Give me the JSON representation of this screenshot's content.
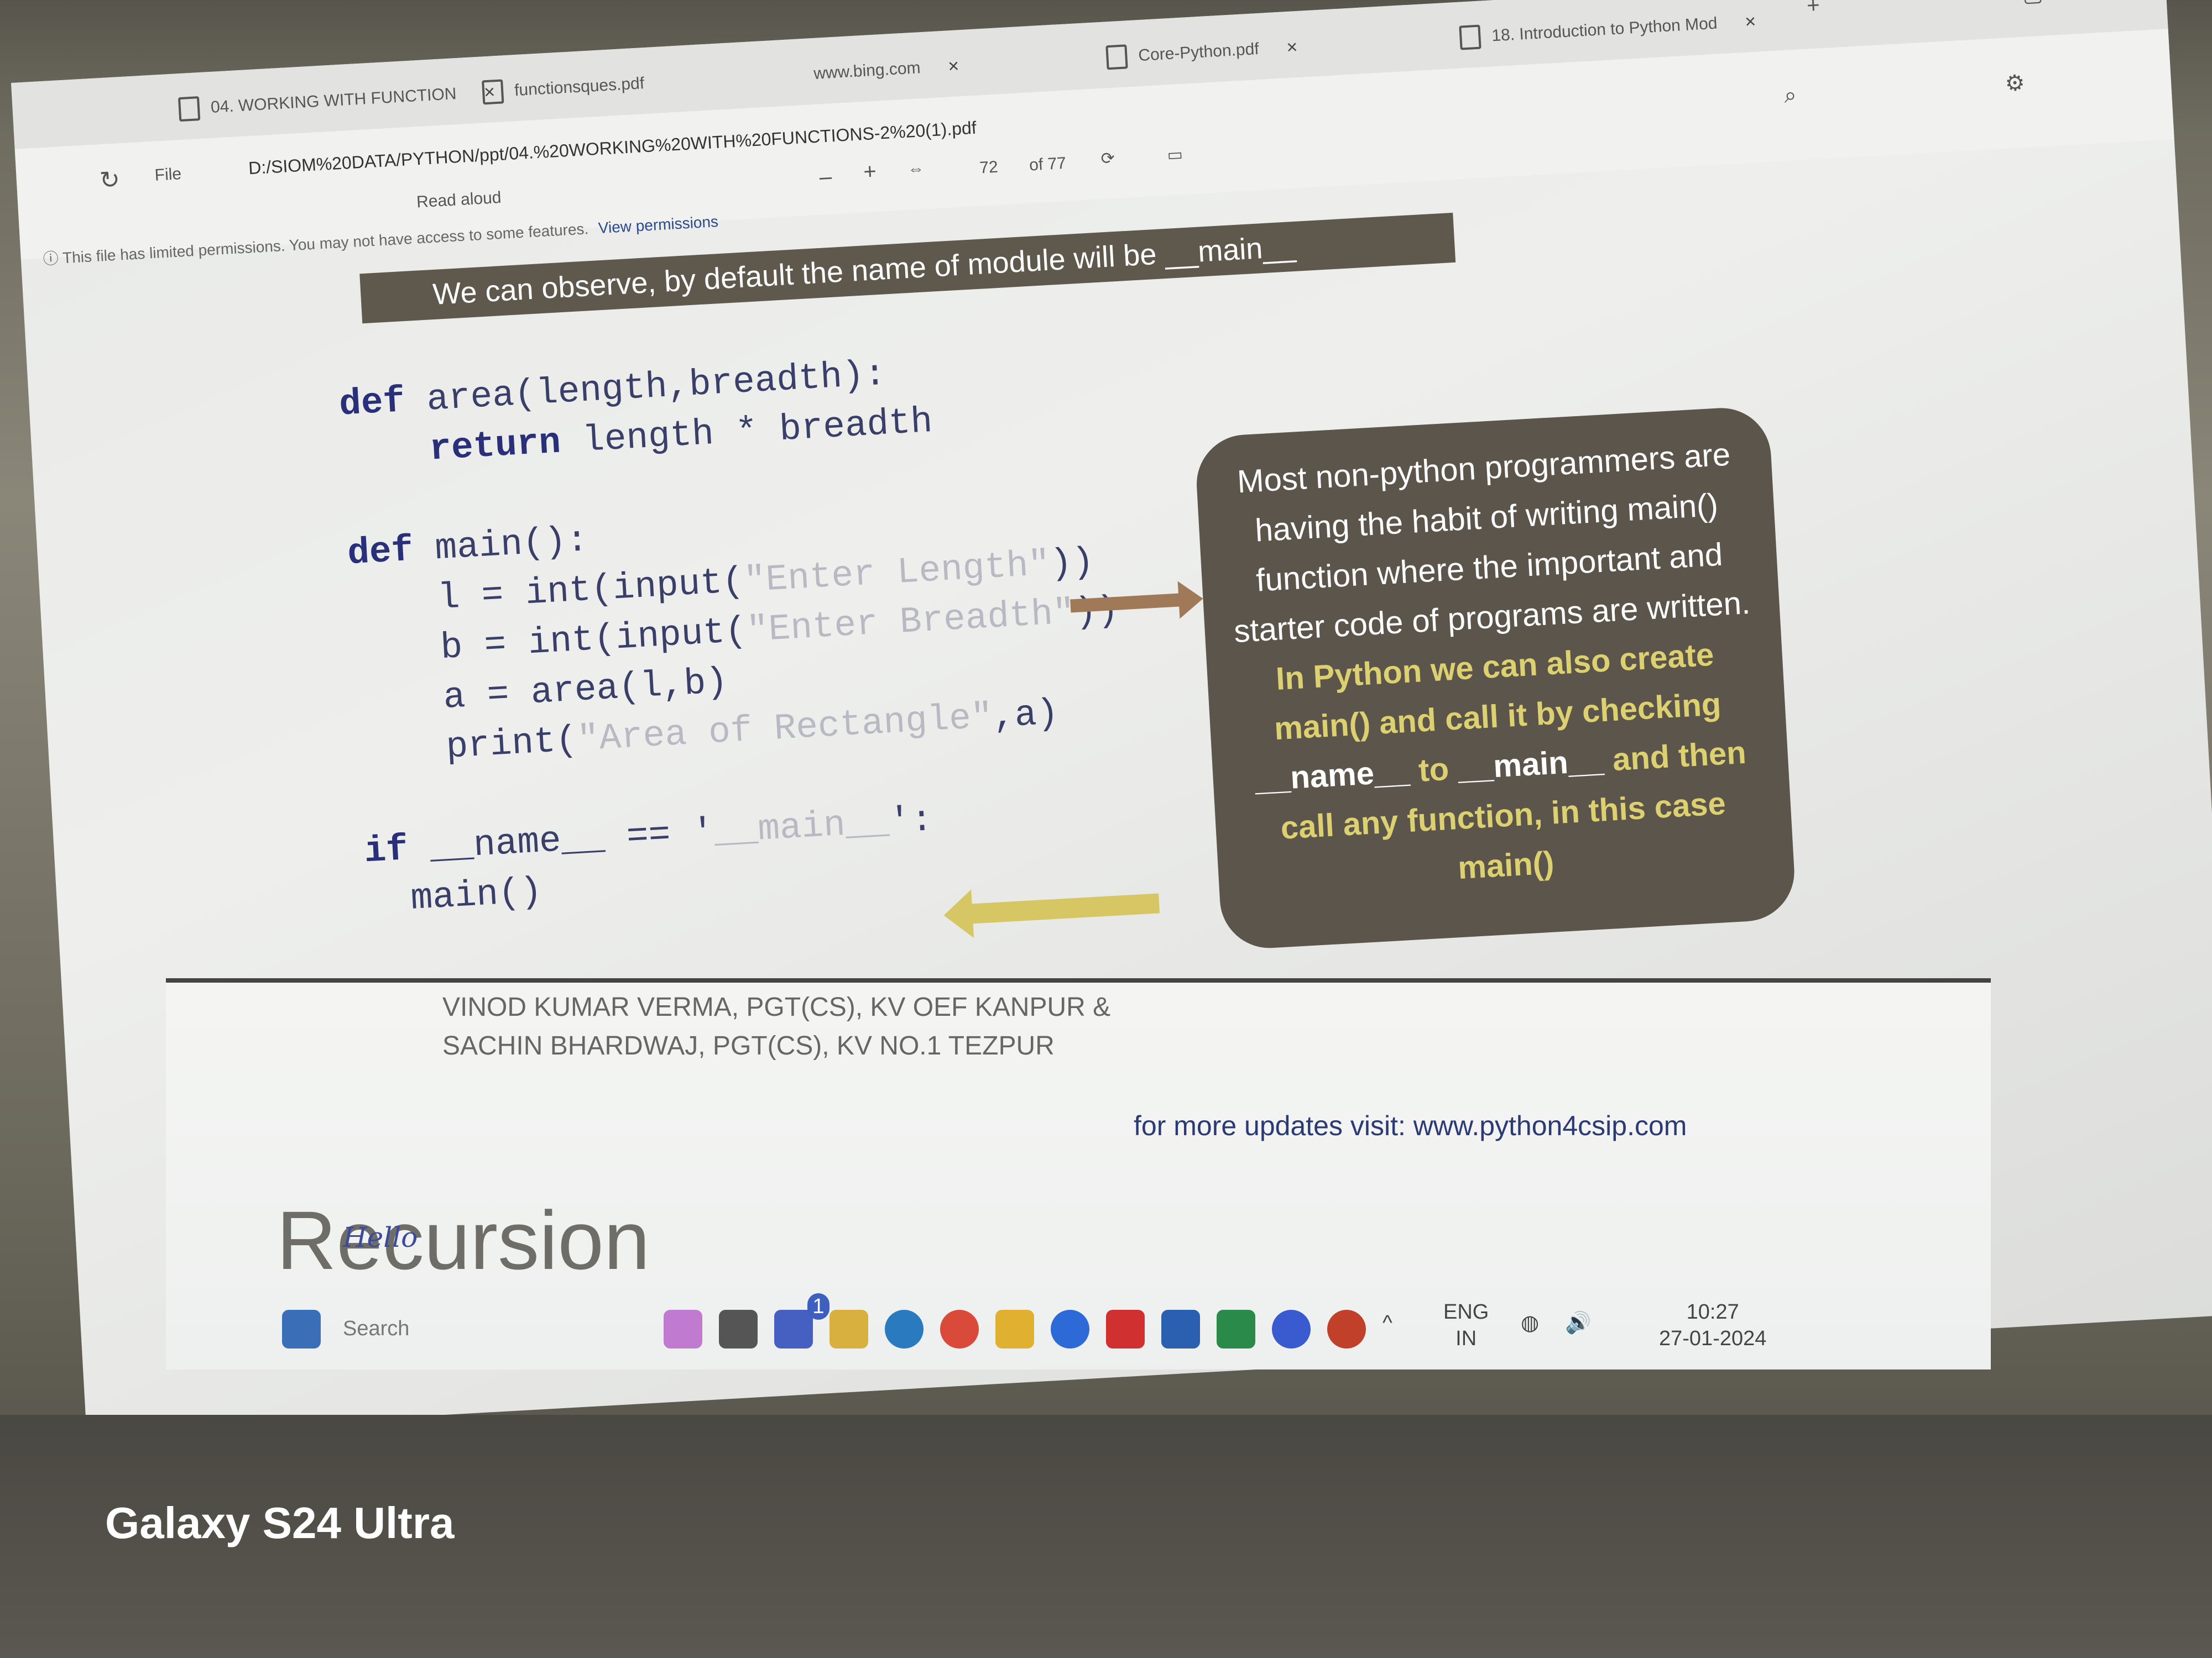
{
  "browser": {
    "tabs": [
      {
        "label": "04. WORKING WITH FUNCTION"
      },
      {
        "label": "functionsques.pdf"
      },
      {
        "label": "www.bing.com"
      },
      {
        "label": "Core-Python.pdf"
      },
      {
        "label": "18. Introduction to Python Mod"
      }
    ],
    "address": "D:/SIOM%20DATA/PYTHON/ppt/04.%20WORKING%20WITH%20FUNCTIONS-2%20(1).pdf",
    "file_label": "File",
    "read_aloud": "Read aloud",
    "page_current": "72",
    "page_total": "of 77",
    "permission_text": "This file has limited permissions. You may not have access to some features.",
    "permission_link": "View permissions"
  },
  "slide": {
    "banner": "We can observe, by default the name of module will be __main__",
    "code": {
      "line1_kw": "def",
      "line1": " area(length,breadth):",
      "line2_kw": "return",
      "line2": " length * breadth",
      "line3_kw": "def",
      "line3": " main():",
      "line4a": "l = int(input(",
      "line4s": "\"Enter Length\"",
      "line4b": "))",
      "line5a": "b = int(input(",
      "line5s": "\"Enter Breadth\"",
      "line5b": "))",
      "line6": "a = area(l,b)",
      "line7a": "print(",
      "line7s": "\"Area of Rectangle\"",
      "line7b": ",a)",
      "line8_kw": "if",
      "line8a": " __name__ == '",
      "line8s": "__main__",
      "line8b": "':",
      "line9": "main()"
    },
    "note": {
      "plain": "Most non-python programmers are having the habit of writing main() function where the important and starter code of programs are written.",
      "highlight1": "In Python we can also create main() and call it by checking",
      "bold1": "__name__",
      "highlight2": "to",
      "bold2": "__main__",
      "highlight3": "and then call any function, in this case main()"
    }
  },
  "lower_slide": {
    "authors_line1": "VINOD KUMAR VERMA, PGT(CS), KV OEF KANPUR &",
    "authors_line2": "SACHIN BHARDWAJ, PGT(CS), KV NO.1 TEZPUR",
    "updates": "for more updates visit: www.python4csip.com",
    "title": "Recursion"
  },
  "handwriting": "Hello",
  "taskbar": {
    "search": "Search",
    "lang": "ENG",
    "region": "IN",
    "time": "10:27",
    "date": "27-01-2024",
    "badge": "1"
  },
  "watermark": "Galaxy S24 Ultra",
  "colors": {
    "banner_bg": "#5e584d",
    "note_bg": "#5b554b",
    "highlight": "#dcd070",
    "code_keyword": "#2a2f7a"
  }
}
